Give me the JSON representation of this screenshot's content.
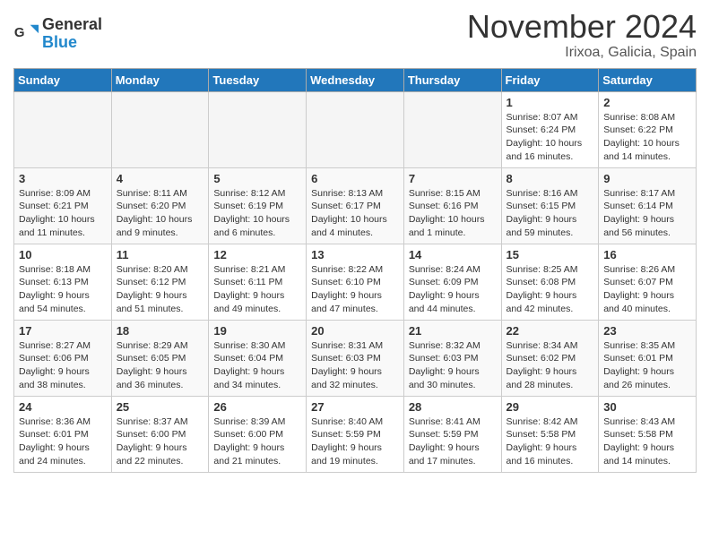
{
  "header": {
    "logo_line1": "General",
    "logo_line2": "Blue",
    "month_title": "November 2024",
    "location": "Irixoa, Galicia, Spain"
  },
  "calendar": {
    "days_of_week": [
      "Sunday",
      "Monday",
      "Tuesday",
      "Wednesday",
      "Thursday",
      "Friday",
      "Saturday"
    ],
    "weeks": [
      [
        {
          "day": "",
          "info": ""
        },
        {
          "day": "",
          "info": ""
        },
        {
          "day": "",
          "info": ""
        },
        {
          "day": "",
          "info": ""
        },
        {
          "day": "",
          "info": ""
        },
        {
          "day": "1",
          "info": "Sunrise: 8:07 AM\nSunset: 6:24 PM\nDaylight: 10 hours\nand 16 minutes."
        },
        {
          "day": "2",
          "info": "Sunrise: 8:08 AM\nSunset: 6:22 PM\nDaylight: 10 hours\nand 14 minutes."
        }
      ],
      [
        {
          "day": "3",
          "info": "Sunrise: 8:09 AM\nSunset: 6:21 PM\nDaylight: 10 hours\nand 11 minutes."
        },
        {
          "day": "4",
          "info": "Sunrise: 8:11 AM\nSunset: 6:20 PM\nDaylight: 10 hours\nand 9 minutes."
        },
        {
          "day": "5",
          "info": "Sunrise: 8:12 AM\nSunset: 6:19 PM\nDaylight: 10 hours\nand 6 minutes."
        },
        {
          "day": "6",
          "info": "Sunrise: 8:13 AM\nSunset: 6:17 PM\nDaylight: 10 hours\nand 4 minutes."
        },
        {
          "day": "7",
          "info": "Sunrise: 8:15 AM\nSunset: 6:16 PM\nDaylight: 10 hours\nand 1 minute."
        },
        {
          "day": "8",
          "info": "Sunrise: 8:16 AM\nSunset: 6:15 PM\nDaylight: 9 hours\nand 59 minutes."
        },
        {
          "day": "9",
          "info": "Sunrise: 8:17 AM\nSunset: 6:14 PM\nDaylight: 9 hours\nand 56 minutes."
        }
      ],
      [
        {
          "day": "10",
          "info": "Sunrise: 8:18 AM\nSunset: 6:13 PM\nDaylight: 9 hours\nand 54 minutes."
        },
        {
          "day": "11",
          "info": "Sunrise: 8:20 AM\nSunset: 6:12 PM\nDaylight: 9 hours\nand 51 minutes."
        },
        {
          "day": "12",
          "info": "Sunrise: 8:21 AM\nSunset: 6:11 PM\nDaylight: 9 hours\nand 49 minutes."
        },
        {
          "day": "13",
          "info": "Sunrise: 8:22 AM\nSunset: 6:10 PM\nDaylight: 9 hours\nand 47 minutes."
        },
        {
          "day": "14",
          "info": "Sunrise: 8:24 AM\nSunset: 6:09 PM\nDaylight: 9 hours\nand 44 minutes."
        },
        {
          "day": "15",
          "info": "Sunrise: 8:25 AM\nSunset: 6:08 PM\nDaylight: 9 hours\nand 42 minutes."
        },
        {
          "day": "16",
          "info": "Sunrise: 8:26 AM\nSunset: 6:07 PM\nDaylight: 9 hours\nand 40 minutes."
        }
      ],
      [
        {
          "day": "17",
          "info": "Sunrise: 8:27 AM\nSunset: 6:06 PM\nDaylight: 9 hours\nand 38 minutes."
        },
        {
          "day": "18",
          "info": "Sunrise: 8:29 AM\nSunset: 6:05 PM\nDaylight: 9 hours\nand 36 minutes."
        },
        {
          "day": "19",
          "info": "Sunrise: 8:30 AM\nSunset: 6:04 PM\nDaylight: 9 hours\nand 34 minutes."
        },
        {
          "day": "20",
          "info": "Sunrise: 8:31 AM\nSunset: 6:03 PM\nDaylight: 9 hours\nand 32 minutes."
        },
        {
          "day": "21",
          "info": "Sunrise: 8:32 AM\nSunset: 6:03 PM\nDaylight: 9 hours\nand 30 minutes."
        },
        {
          "day": "22",
          "info": "Sunrise: 8:34 AM\nSunset: 6:02 PM\nDaylight: 9 hours\nand 28 minutes."
        },
        {
          "day": "23",
          "info": "Sunrise: 8:35 AM\nSunset: 6:01 PM\nDaylight: 9 hours\nand 26 minutes."
        }
      ],
      [
        {
          "day": "24",
          "info": "Sunrise: 8:36 AM\nSunset: 6:01 PM\nDaylight: 9 hours\nand 24 minutes."
        },
        {
          "day": "25",
          "info": "Sunrise: 8:37 AM\nSunset: 6:00 PM\nDaylight: 9 hours\nand 22 minutes."
        },
        {
          "day": "26",
          "info": "Sunrise: 8:39 AM\nSunset: 6:00 PM\nDaylight: 9 hours\nand 21 minutes."
        },
        {
          "day": "27",
          "info": "Sunrise: 8:40 AM\nSunset: 5:59 PM\nDaylight: 9 hours\nand 19 minutes."
        },
        {
          "day": "28",
          "info": "Sunrise: 8:41 AM\nSunset: 5:59 PM\nDaylight: 9 hours\nand 17 minutes."
        },
        {
          "day": "29",
          "info": "Sunrise: 8:42 AM\nSunset: 5:58 PM\nDaylight: 9 hours\nand 16 minutes."
        },
        {
          "day": "30",
          "info": "Sunrise: 8:43 AM\nSunset: 5:58 PM\nDaylight: 9 hours\nand 14 minutes."
        }
      ]
    ]
  }
}
